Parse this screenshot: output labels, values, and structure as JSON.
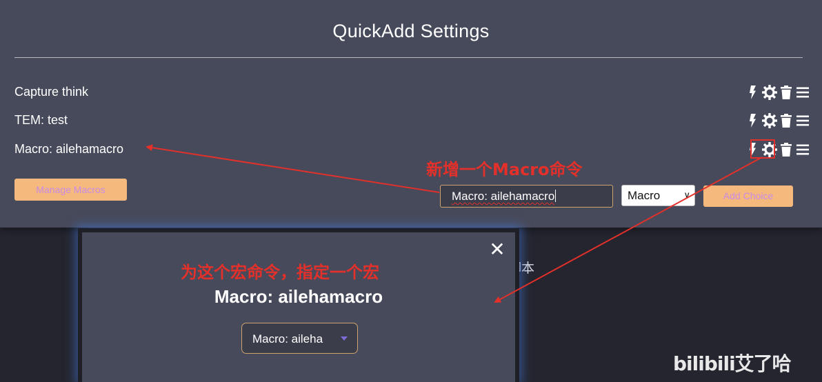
{
  "page_title": "QuickAdd Settings",
  "choices": [
    {
      "label": "Capture think"
    },
    {
      "label": "TEM: test"
    },
    {
      "label": "Macro: ailehamacro"
    }
  ],
  "choice_actions": {
    "icons": [
      "bolt-icon",
      "gear-icon",
      "trash-icon",
      "drag-handle-icon"
    ]
  },
  "manage_macros_label": "Manage Macros",
  "new_choice": {
    "name_value": "Macro: ailehamacro",
    "type_value": "Macro",
    "add_label": "Add Choice"
  },
  "modal": {
    "close_symbol": "✕",
    "title": "Macro: ailehamacro",
    "selected_macro": "Macro: aileha",
    "background_text": "脚本"
  },
  "annotations": {
    "new_macro_command": "新增一个Macro命令",
    "assign_macro": "为这个宏命令，指定一个宏"
  },
  "watermark": "bilibili艾了哈",
  "colors": {
    "panel_bg": "#474a5a",
    "accent_orange": "#f5b97d",
    "annotation_red": "#e3302a"
  }
}
